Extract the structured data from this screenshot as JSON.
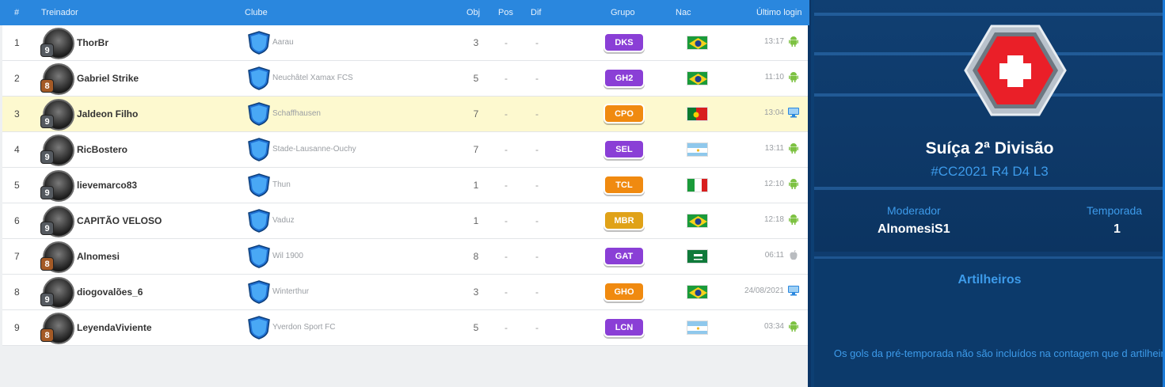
{
  "table": {
    "headers": {
      "num": "#",
      "trainer": "Treinador",
      "club": "Clube",
      "obj": "Obj",
      "pos": "Pos",
      "dif": "Dif",
      "group": "Grupo",
      "nac": "Nac",
      "last_login": "Último login"
    },
    "rows": [
      {
        "num": "1",
        "level": "9",
        "name": "ThorBr",
        "club": "Aarau",
        "obj": "3",
        "pos": "-",
        "dif": "-",
        "group": "DKS",
        "group_color": "#8a3fd6",
        "flag": "brazil",
        "time": "13:17",
        "device": "android-icon"
      },
      {
        "num": "2",
        "level": "8",
        "name": "Gabriel Strike",
        "club": "Neuchâtel Xamax FCS",
        "obj": "5",
        "pos": "-",
        "dif": "-",
        "group": "GH2",
        "group_color": "#8a3fd6",
        "flag": "brazil",
        "time": "11:10",
        "device": "android-icon"
      },
      {
        "num": "3",
        "level": "9",
        "name": "Jaldeon Filho",
        "club": "Schaffhausen",
        "obj": "7",
        "pos": "-",
        "dif": "-",
        "group": "CPO",
        "group_color": "#f08a10",
        "flag": "portugal",
        "time": "13:04",
        "device": "desktop-icon"
      },
      {
        "num": "4",
        "level": "9",
        "name": "RicBostero",
        "club": "Stade-Lausanne-Ouchy",
        "obj": "7",
        "pos": "-",
        "dif": "-",
        "group": "SEL",
        "group_color": "#8a3fd6",
        "flag": "argentina",
        "time": "13:11",
        "device": "android-icon"
      },
      {
        "num": "5",
        "level": "9",
        "name": "lievemarco83",
        "club": "Thun",
        "obj": "1",
        "pos": "-",
        "dif": "-",
        "group": "TCL",
        "group_color": "#f08a10",
        "flag": "italy",
        "time": "12:10",
        "device": "android-icon"
      },
      {
        "num": "6",
        "level": "9",
        "name": "CAPITÃO VELOSO",
        "club": "Vaduz",
        "obj": "1",
        "pos": "-",
        "dif": "-",
        "group": "MBR",
        "group_color": "#e0a218",
        "flag": "brazil",
        "time": "12:18",
        "device": "android-icon"
      },
      {
        "num": "7",
        "level": "8",
        "name": "Alnomesi",
        "club": "Wil 1900",
        "obj": "8",
        "pos": "-",
        "dif": "-",
        "group": "GAT",
        "group_color": "#8a3fd6",
        "flag": "saudi",
        "time": "06:11",
        "device": "apple-icon"
      },
      {
        "num": "8",
        "level": "9",
        "name": "diogovalões_6",
        "club": "Winterthur",
        "obj": "3",
        "pos": "-",
        "dif": "-",
        "group": "GHO",
        "group_color": "#f08a10",
        "flag": "brazil",
        "time": "24/08/2021",
        "device": "desktop-icon"
      },
      {
        "num": "9",
        "level": "8",
        "name": "LeyendaViviente",
        "club": "Yverdon Sport FC",
        "obj": "5",
        "pos": "-",
        "dif": "-",
        "group": "LCN",
        "group_color": "#8a3fd6",
        "flag": "argentina",
        "time": "03:34",
        "device": "android-icon"
      }
    ]
  },
  "league": {
    "name": "Suíça 2ª Divisão",
    "code": "#CC2021 R4 D4 L3",
    "moderator_label": "Moderador",
    "moderator": "AlnomesiS1",
    "season_label": "Temporada",
    "season": "1",
    "badge_icon": "switzerland-cross-icon"
  },
  "scorers": {
    "title": "Artilheiros",
    "note": "Os gols da pré-temporada não são incluídos na contagem que d artilheiro"
  }
}
